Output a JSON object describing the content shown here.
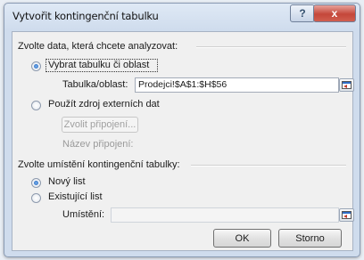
{
  "window": {
    "title": "Vytvořit kontingenční tabulku",
    "help_symbol": "?",
    "close_symbol": "x"
  },
  "data_section": {
    "heading": "Zvolte data, která chcete analyzovat:",
    "option_table_range": "Vybrat tabulku či oblast",
    "table_range_label": "Tabulka/oblast:",
    "table_range_value": "Prodejci!$A$1:$H$56",
    "option_external": "Použít zdroj externích dat",
    "choose_connection_button": "Zvolit připojení...",
    "connection_name_label": "Název připojení:"
  },
  "location_section": {
    "heading": "Zvolte umístění kontingenční tabulky:",
    "option_new_sheet": "Nový list",
    "option_existing_sheet": "Existující list",
    "location_label": "Umístění:",
    "location_value": ""
  },
  "buttons": {
    "ok": "OK",
    "cancel": "Storno"
  },
  "state": {
    "data_source": "table_range",
    "destination": "new_sheet"
  },
  "colors": {
    "accent": "#1d5fb8",
    "close": "#c4473a"
  }
}
